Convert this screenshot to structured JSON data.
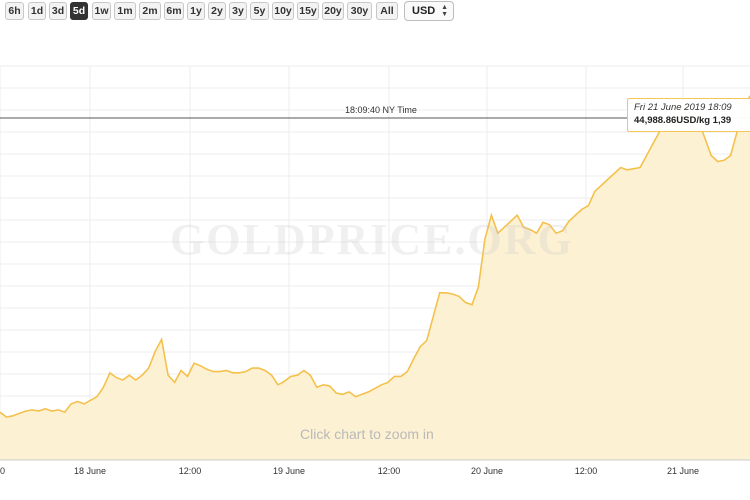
{
  "toolbar": {
    "ranges": [
      "6h",
      "1d",
      "3d",
      "5d",
      "1w",
      "1m",
      "2m",
      "6m",
      "1y",
      "2y",
      "3y",
      "5y",
      "10y",
      "15y",
      "20y",
      "30y",
      "All"
    ],
    "active_range": "5d",
    "currency": "USD"
  },
  "chart": {
    "watermark": "GOLDPRICE.ORG",
    "zoom_hint": "Click chart to zoom in",
    "crosshair_label": "18:09:40 NY Time",
    "tooltip": {
      "date": "Fri 21 June 2019 18:09",
      "value": "44,988.86USD/kg 1,39"
    }
  },
  "chart_data": {
    "type": "area",
    "x_ticks": [
      "0",
      "18 June",
      "12:00",
      "19 June",
      "12:00",
      "20 June",
      "12:00",
      "21 June"
    ],
    "series": [
      {
        "values": [
          42650,
          42610,
          42620,
          42640,
          42660,
          42670,
          42660,
          42680,
          42660,
          42670,
          42650,
          42720,
          42740,
          42720,
          42750,
          42780,
          42860,
          42980,
          42940,
          42920,
          42960,
          42920,
          42960,
          43020,
          43160,
          43260,
          42960,
          42900,
          43000,
          42950,
          43060,
          43040,
          43010,
          42990,
          42990,
          43000,
          42980,
          42980,
          42990,
          43020,
          43020,
          43000,
          42960,
          42880,
          42910,
          42950,
          42960,
          43000,
          42960,
          42860,
          42880,
          42870,
          42810,
          42800,
          42820,
          42780,
          42800,
          42820,
          42850,
          42880,
          42900,
          42950,
          42950,
          42990,
          43100,
          43200,
          43250,
          43450,
          43650,
          43650,
          43640,
          43620,
          43570,
          43550,
          43700,
          44100,
          44300,
          44150,
          44200,
          44250,
          44300,
          44200,
          44180,
          44150,
          44240,
          44220,
          44150,
          44170,
          44250,
          44300,
          44350,
          44380,
          44500,
          44550,
          44600,
          44650,
          44700,
          44680,
          44690,
          44700,
          44800,
          44900,
          45000,
          45100,
          45200,
          45250,
          45200,
          45180,
          45100,
          44950,
          44800,
          44750,
          44760,
          44800,
          45000,
          45200,
          45300
        ]
      }
    ],
    "grid": true
  }
}
